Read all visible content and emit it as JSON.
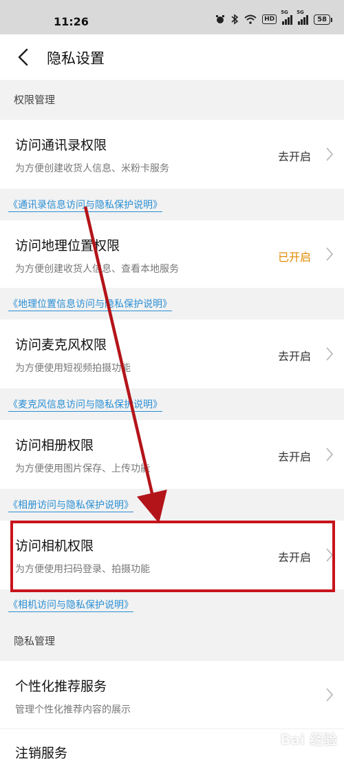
{
  "status_bar": {
    "time": "11:26",
    "hd": "HD",
    "sig1": "5G",
    "sig2": "5G",
    "battery": "58"
  },
  "header": {
    "title": "隐私设置"
  },
  "sections": {
    "permissions": "权限管理",
    "privacy": "隐私管理"
  },
  "rows": [
    {
      "title": "访问通讯录权限",
      "sub": "为方便创建收货人信息、米粉卡服务",
      "status": "去开启",
      "link": "《通讯录信息访问与隐私保护说明》"
    },
    {
      "title": "访问地理位置权限",
      "sub": "为方便创建收货人信息、查看本地服务",
      "status": "已开启",
      "link": "《地理位置信息访问与隐私保护说明》"
    },
    {
      "title": "访问麦克风权限",
      "sub": "为方便使用短视频拍摄功能",
      "status": "去开启",
      "link": "《麦克风信息访问与隐私保护说明》"
    },
    {
      "title": "访问相册权限",
      "sub": "为方便使用图片保存、上传功能",
      "status": "去开启",
      "link": "《相册访问与隐私保护说明》"
    },
    {
      "title": "访问相机权限",
      "sub": "为方便使用扫码登录、拍摄功能",
      "status": "去开启",
      "link": "《相机访问与隐私保护说明》"
    }
  ],
  "privacy_rows": [
    {
      "title": "个性化推荐服务",
      "sub": "管理个性化推荐内容的展示"
    },
    {
      "title": "注销服务"
    }
  ],
  "watermark": "Bai 经验",
  "colors": {
    "accent_on": "#e08a00",
    "link": "#2a8fd4",
    "annotation": "#c8141c"
  }
}
